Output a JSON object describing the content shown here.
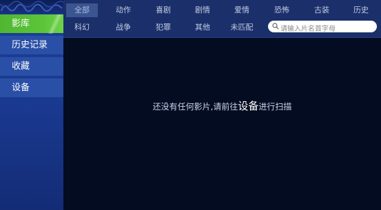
{
  "sidebar": {
    "items": [
      {
        "label": "影库",
        "active": true
      },
      {
        "label": "历史记录",
        "active": false
      },
      {
        "label": "收藏",
        "active": false
      },
      {
        "label": "设备",
        "active": false
      }
    ]
  },
  "genres": {
    "row1": [
      "全部",
      "动作",
      "喜剧",
      "剧情",
      "爱情",
      "恐怖",
      "古装",
      "历史"
    ],
    "row2": [
      "科幻",
      "战争",
      "犯罪",
      "其他",
      "未匹配"
    ],
    "selected": "全部"
  },
  "search": {
    "placeholder": "请输入片名首字母",
    "value": "",
    "icon": "search-icon"
  },
  "empty_message": {
    "prefix": "还没有任何影片,请前往",
    "link": "设备",
    "suffix": "进行扫描"
  },
  "colors": {
    "active_nav": "#5cc63a",
    "sidebar": "#2a4fa7",
    "topbar": "#1b2f6a",
    "background": "#040c22"
  }
}
